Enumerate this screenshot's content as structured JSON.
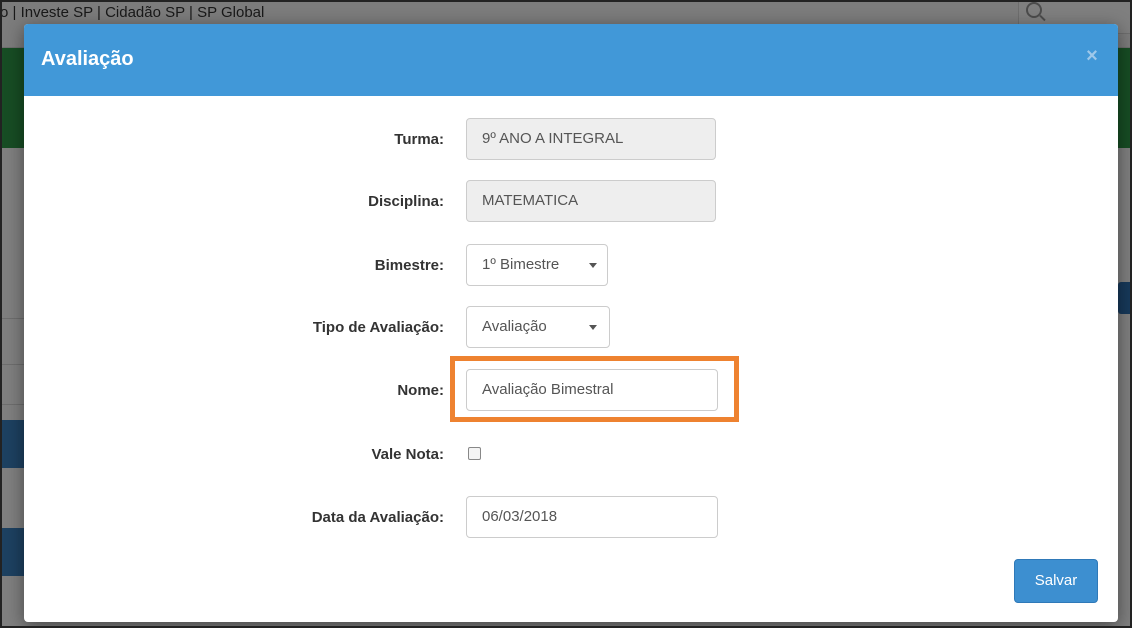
{
  "background": {
    "top_links": "o | Investe SP | Cidadão SP | SP Global"
  },
  "modal": {
    "title": "Avaliação",
    "close_label": "×",
    "save_label": "Salvar"
  },
  "form": {
    "turma": {
      "label": "Turma:",
      "value": "9º ANO A INTEGRAL"
    },
    "disciplina": {
      "label": "Disciplina:",
      "value": "MATEMATICA"
    },
    "bimestre": {
      "label": "Bimestre:",
      "value": "1º Bimestre"
    },
    "tipo": {
      "label": "Tipo de Avaliação:",
      "value": "Avaliação"
    },
    "nome": {
      "label": "Nome:",
      "value": "Avaliação Bimestral"
    },
    "vale_nota": {
      "label": "Vale Nota:",
      "checked": false
    },
    "data": {
      "label": "Data da Avaliação:",
      "value": "06/03/2018"
    }
  },
  "colors": {
    "header": "#4198d8",
    "highlight": "#ee8230",
    "save_button": "#3d8fd0",
    "background_green": "#2e9b48"
  }
}
